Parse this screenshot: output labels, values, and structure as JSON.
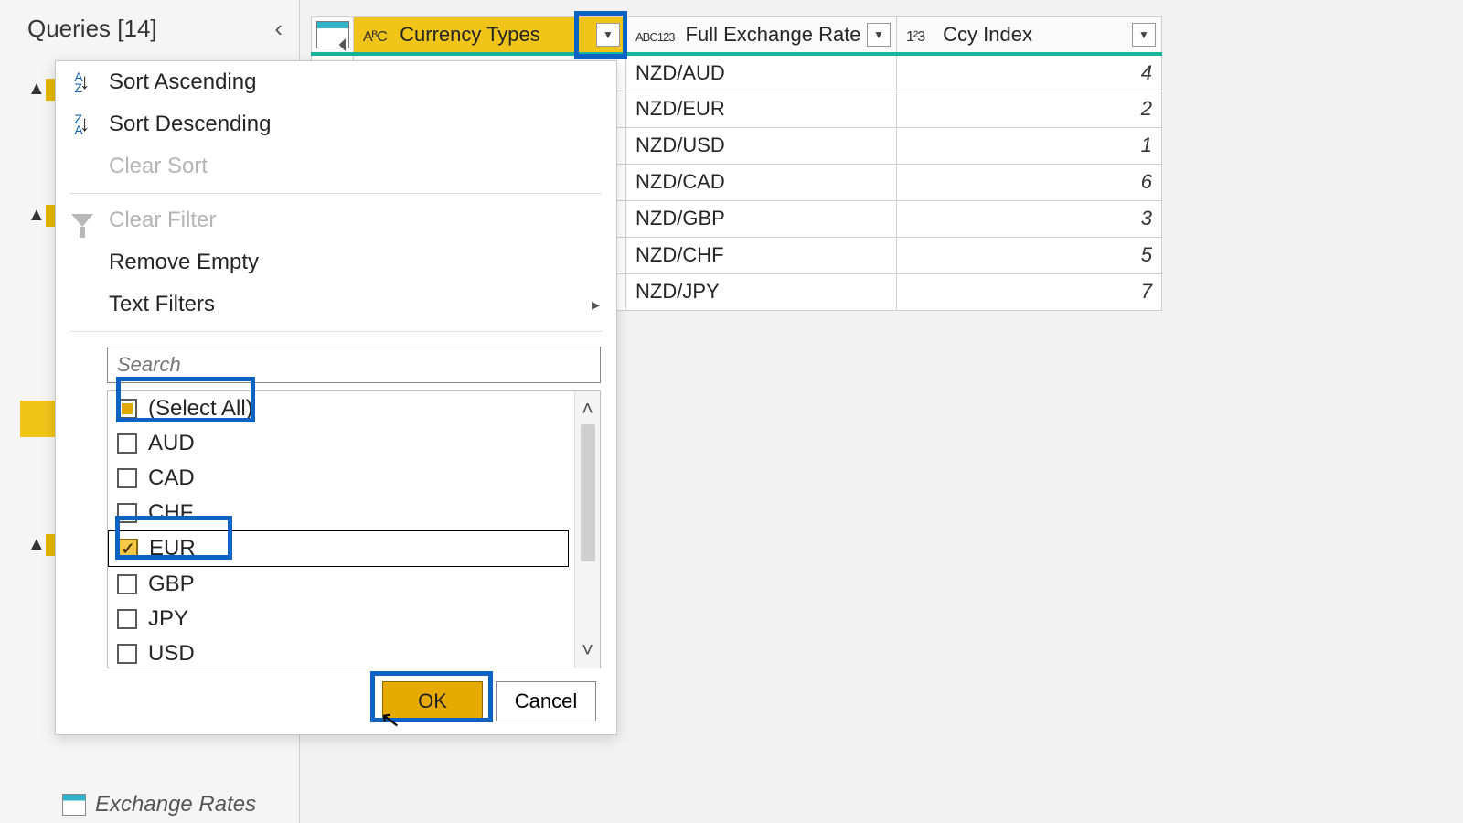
{
  "sidebar": {
    "title": "Queries [14]",
    "bottom_item": "Exchange Rates"
  },
  "table": {
    "columns": [
      {
        "type_label": "AᴮC",
        "name": "Currency Types",
        "selected": true
      },
      {
        "type_label": "ABC123",
        "name": "Full Exchange Rate",
        "selected": false
      },
      {
        "type_label": "1²3",
        "name": "Ccy Index",
        "selected": false
      }
    ],
    "rows": [
      {
        "full_rate": "NZD/AUD",
        "ccy_index": 4
      },
      {
        "full_rate": "NZD/EUR",
        "ccy_index": 2
      },
      {
        "full_rate": "NZD/USD",
        "ccy_index": 1
      },
      {
        "full_rate": "NZD/CAD",
        "ccy_index": 6
      },
      {
        "full_rate": "NZD/GBP",
        "ccy_index": 3
      },
      {
        "full_rate": "NZD/CHF",
        "ccy_index": 5
      },
      {
        "full_rate": "NZD/JPY",
        "ccy_index": 7
      }
    ]
  },
  "filter_menu": {
    "sort_asc": "Sort Ascending",
    "sort_desc": "Sort Descending",
    "clear_sort": "Clear Sort",
    "clear_filter": "Clear Filter",
    "remove_empty": "Remove Empty",
    "text_filters": "Text Filters",
    "search_placeholder": "Search",
    "values": [
      {
        "label": "(Select All)",
        "state": "indeterminate"
      },
      {
        "label": "AUD",
        "state": "unchecked"
      },
      {
        "label": "CAD",
        "state": "unchecked"
      },
      {
        "label": "CHF",
        "state": "unchecked"
      },
      {
        "label": "EUR",
        "state": "checked"
      },
      {
        "label": "GBP",
        "state": "unchecked"
      },
      {
        "label": "JPY",
        "state": "unchecked"
      },
      {
        "label": "USD",
        "state": "unchecked"
      }
    ],
    "ok": "OK",
    "cancel": "Cancel"
  }
}
